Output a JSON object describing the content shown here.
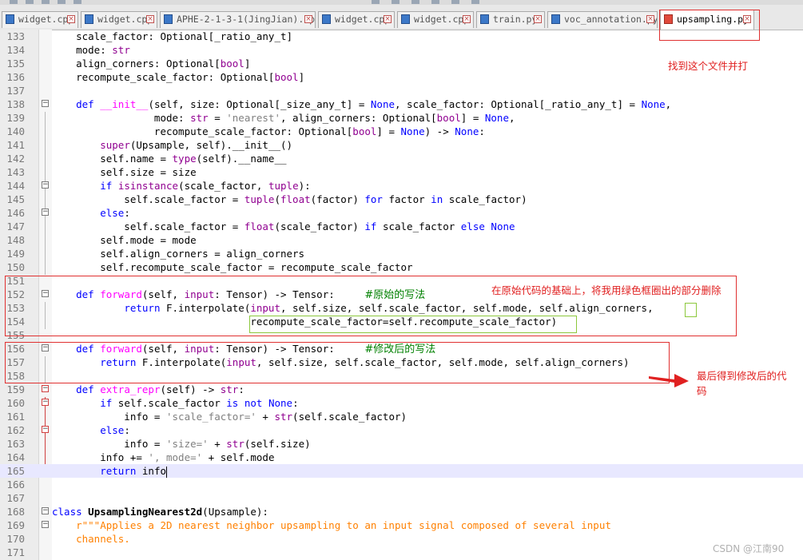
{
  "tabs": [
    {
      "label": "widget.cpp",
      "active": false
    },
    {
      "label": "widget.cpp",
      "active": false
    },
    {
      "label": "APHE-2-1-3-1(JingJian).cpp",
      "active": false
    },
    {
      "label": "widget.cpp",
      "active": false
    },
    {
      "label": "widget.cpp",
      "active": false
    },
    {
      "label": "train.py",
      "active": false
    },
    {
      "label": "voc_annotation.py",
      "active": false
    },
    {
      "label": "upsampling.py",
      "active": true
    }
  ],
  "lines": [
    {
      "n": "133"
    },
    {
      "n": "134"
    },
    {
      "n": "135"
    },
    {
      "n": "136"
    },
    {
      "n": "137"
    },
    {
      "n": "138"
    },
    {
      "n": "139"
    },
    {
      "n": "140"
    },
    {
      "n": "141"
    },
    {
      "n": "142"
    },
    {
      "n": "143"
    },
    {
      "n": "144"
    },
    {
      "n": "145"
    },
    {
      "n": "146"
    },
    {
      "n": "147"
    },
    {
      "n": "148"
    },
    {
      "n": "149"
    },
    {
      "n": "150"
    },
    {
      "n": "151"
    },
    {
      "n": "152"
    },
    {
      "n": "153"
    },
    {
      "n": "154"
    },
    {
      "n": "155"
    },
    {
      "n": "156"
    },
    {
      "n": "157"
    },
    {
      "n": "158"
    },
    {
      "n": "159"
    },
    {
      "n": "160"
    },
    {
      "n": "161"
    },
    {
      "n": "162"
    },
    {
      "n": "163"
    },
    {
      "n": "164"
    },
    {
      "n": "165"
    },
    {
      "n": "166"
    },
    {
      "n": "167"
    },
    {
      "n": "168"
    },
    {
      "n": "169"
    },
    {
      "n": "170"
    },
    {
      "n": "171"
    }
  ],
  "code": {
    "l133": "    scale_factor: Optional[_ratio_any_t]",
    "l134a": "    mode: ",
    "l134b": "str",
    "l135a": "    align_corners: Optional[",
    "l135b": "bool",
    "l135c": "]",
    "l136a": "    recompute_scale_factor: Optional[",
    "l136b": "bool",
    "l136c": "]",
    "l138a": "    ",
    "l138b": "def",
    "l138c": " ",
    "l138d": "__init__",
    "l138e": "(self, size: Optional[_size_any_t] = ",
    "l138f": "None",
    "l138g": ", scale_factor: Optional[_ratio_any_t] = ",
    "l138h": "None",
    "l138i": ",",
    "l139a": "                 mode: ",
    "l139b": "str",
    "l139c": " = ",
    "l139d": "'nearest'",
    "l139e": ", align_corners: Optional[",
    "l139f": "bool",
    "l139g": "] = ",
    "l139h": "None",
    "l139i": ",",
    "l140a": "                 recompute_scale_factor: Optional[",
    "l140b": "bool",
    "l140c": "] = ",
    "l140d": "None",
    "l140e": ") -> ",
    "l140f": "None",
    "l140g": ":",
    "l141a": "        ",
    "l141b": "super",
    "l141c": "(Upsample, self).__init__()",
    "l142a": "        self.name = ",
    "l142b": "type",
    "l142c": "(self).__name__",
    "l143": "        self.size = size",
    "l144a": "        ",
    "l144b": "if",
    "l144c": " ",
    "l144d": "isinstance",
    "l144e": "(scale_factor, ",
    "l144f": "tuple",
    "l144g": "):",
    "l145a": "            self.scale_factor = ",
    "l145b": "tuple",
    "l145c": "(",
    "l145d": "float",
    "l145e": "(factor) ",
    "l145f": "for",
    "l145g": " factor ",
    "l145h": "in",
    "l145i": " scale_factor)",
    "l146a": "        ",
    "l146b": "else",
    "l146c": ":",
    "l147a": "            self.scale_factor = ",
    "l147b": "float",
    "l147c": "(scale_factor) ",
    "l147d": "if",
    "l147e": " scale_factor ",
    "l147f": "else",
    "l147g": " ",
    "l147h": "None",
    "l148": "        self.mode = mode",
    "l149": "        self.align_corners = align_corners",
    "l150": "        self.recompute_scale_factor = recompute_scale_factor",
    "l152a": "    ",
    "l152b": "def",
    "l152c": " ",
    "l152d": "forward",
    "l152e": "(self, ",
    "l152f": "input",
    "l152g": ": Tensor) -> Tensor:     ",
    "l152h": "#原始的写法",
    "l153a": "            ",
    "l153b": "return",
    "l153c": " F.interpolate(",
    "l153d": "input",
    "l153e": ", self.size, self.scale_factor, self.mode, self.align_corners,",
    "l154": "                                 recompute_scale_factor=self.recompute_scale_factor)",
    "l156a": "    ",
    "l156b": "def",
    "l156c": " ",
    "l156d": "forward",
    "l156e": "(self, ",
    "l156f": "input",
    "l156g": ": Tensor) -> Tensor:     ",
    "l156h": "#修改后的写法",
    "l157a": "        ",
    "l157b": "return",
    "l157c": " F.interpolate(",
    "l157d": "input",
    "l157e": ", self.size, self.scale_factor, self.mode, self.align_corners)",
    "l159a": "    ",
    "l159b": "def",
    "l159c": " ",
    "l159d": "extra_repr",
    "l159e": "(self) -> ",
    "l159f": "str",
    "l159g": ":",
    "l160a": "        ",
    "l160b": "if",
    "l160c": " self.scale_factor ",
    "l160d": "is not",
    "l160e": " ",
    "l160f": "None",
    "l160g": ":",
    "l161a": "            info = ",
    "l161b": "'scale_factor='",
    "l161c": " + ",
    "l161d": "str",
    "l161e": "(self.scale_factor)",
    "l162a": "        ",
    "l162b": "else",
    "l162c": ":",
    "l163a": "            info = ",
    "l163b": "'size='",
    "l163c": " + ",
    "l163d": "str",
    "l163e": "(self.size)",
    "l164a": "        info += ",
    "l164b": "', mode='",
    "l164c": " + self.mode",
    "l165a": "        ",
    "l165b": "return",
    "l165c": " info",
    "l168a": "",
    "l168b": "class",
    "l168c": " ",
    "l168d": "UpsamplingNearest2d",
    "l168e": "(Upsample):",
    "l169": "    r\"\"\"Applies a 2D nearest neighbor upsampling to an input signal composed of several input",
    "l170": "    channels."
  },
  "annotations": {
    "open_file": "找到这个文件并打",
    "delete_note": "在原始代码的基础上，将我用绿色框圈出的部分删除",
    "result_line1": "最后得到修改后的代",
    "result_line2": "码"
  },
  "watermark": "CSDN @江南90"
}
